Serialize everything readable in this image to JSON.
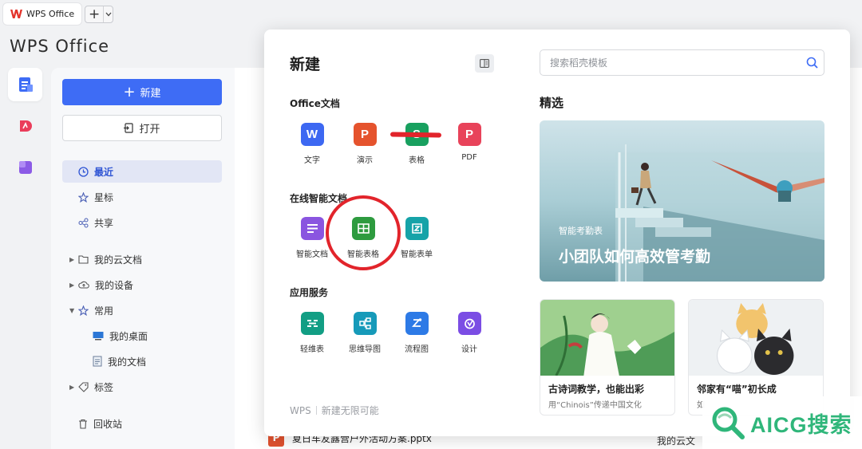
{
  "tabbar": {
    "tab_title": "WPS Office",
    "new_tab": "+"
  },
  "brand": "WPS Office",
  "sidebar": {
    "new_label": "新建",
    "open_label": "打开",
    "nav": [
      {
        "label": "最近"
      },
      {
        "label": "星标"
      },
      {
        "label": "共享"
      },
      {
        "label": "我的云文档"
      },
      {
        "label": "我的设备"
      },
      {
        "label": "常用"
      },
      {
        "label": "我的桌面"
      },
      {
        "label": "我的文档"
      },
      {
        "label": "标签"
      },
      {
        "label": "回收站"
      }
    ]
  },
  "background": {
    "recent_file": "夏日车友露营户外活动方案.pptx",
    "file_location": "我的云文"
  },
  "modal": {
    "title": "新建",
    "office_section": "Office文档",
    "office_items": [
      {
        "label": "文字",
        "letter": "W",
        "color": "#3d68f2"
      },
      {
        "label": "演示",
        "letter": "P",
        "color": "#e5532d"
      },
      {
        "label": "表格",
        "letter": "S",
        "color": "#18a05f"
      },
      {
        "label": "PDF",
        "letter": "P",
        "color": "#e8435a"
      }
    ],
    "smart_section": "在线智能文档",
    "smart_items": [
      {
        "label": "智能文档",
        "color": "#8a55e0"
      },
      {
        "label": "智能表格",
        "color": "#2e9b3f"
      },
      {
        "label": "智能表单",
        "color": "#16a3a8"
      }
    ],
    "service_section": "应用服务",
    "service_items": [
      {
        "label": "轻维表",
        "color": "#129e84"
      },
      {
        "label": "思维导图",
        "color": "#169ab9"
      },
      {
        "label": "流程图",
        "color": "#2d7ae6"
      },
      {
        "label": "设计",
        "color": "#7b4de4"
      }
    ],
    "footer_brand": "WPS",
    "footer_slogan": "新建无限可能",
    "search_placeholder": "搜索稻壳模板",
    "featured_title": "精选",
    "banner": {
      "subtitle": "智能考勤表",
      "title": "小团队如何高效管考勤"
    },
    "cards": [
      {
        "title": "古诗词教学，也能出彩",
        "subtitle": "用“Chinois”传递中国文化"
      },
      {
        "title": "邻家有“喵”初长成",
        "subtitle": "如"
      }
    ]
  },
  "watermark": "AICG搜索",
  "colors": {
    "primary": "#3e6cf5",
    "annotation_red": "#e2242b",
    "watermark_green": "#2fb67a"
  }
}
